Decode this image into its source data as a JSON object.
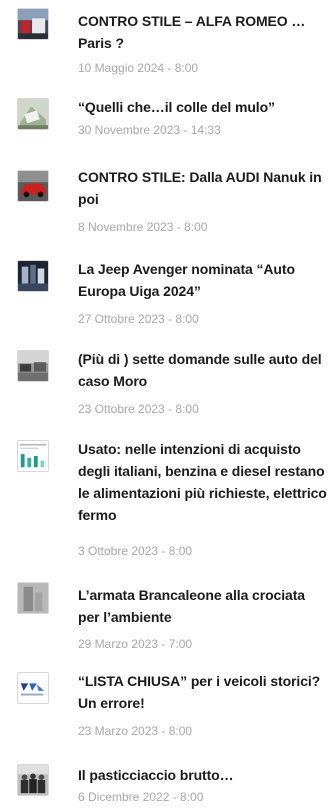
{
  "articles": [
    {
      "title": "CONTRO STILE – ALFA ROMEO … Paris ?",
      "date": "10 Maggio 2024 - 8:00",
      "thumb_icon": "car-red-thumbnail"
    },
    {
      "title": "“Quelli che…il colle del mulo”",
      "date": "30 Novembre 2023 - 14:33",
      "thumb_icon": "mountain-road-thumbnail"
    },
    {
      "title": "CONTRO STILE: Dalla AUDI Nanuk in poi",
      "date": "8 Novembre 2023 - 8:00",
      "thumb_icon": "red-sports-car-thumbnail"
    },
    {
      "title": "La Jeep Avenger nominata “Auto Europa Uiga 2024”",
      "date": "27 Ottobre 2023 - 8:00",
      "thumb_icon": "award-stage-thumbnail"
    },
    {
      "title": "(Più di ) sette domande sulle auto del caso Moro",
      "date": "23 Ottobre 2023 - 8:00",
      "thumb_icon": "archive-photo-thumbnail"
    },
    {
      "title": "Usato: nelle intenzioni di acquisto degli italiani, benzina e diesel restano le alimentazioni più richieste, elettrico fermo",
      "date": "3 Ottobre 2023 - 8:00",
      "thumb_icon": "bar-chart-thumbnail"
    },
    {
      "title": "L’armata Brancaleone alla crociata per l’ambiente",
      "date": "29 Marzo 2023 - 7:00",
      "thumb_icon": "foggy-building-thumbnail"
    },
    {
      "title": "“LISTA CHIUSA” per i veicoli storici? Un errore!",
      "date": "23 Marzo 2023 - 8:00",
      "thumb_icon": "logo-thumbnail"
    },
    {
      "title": "Il pasticciaccio brutto…",
      "date": "6 Dicembre 2022 - 8:00",
      "thumb_icon": "group-people-thumbnail"
    }
  ]
}
